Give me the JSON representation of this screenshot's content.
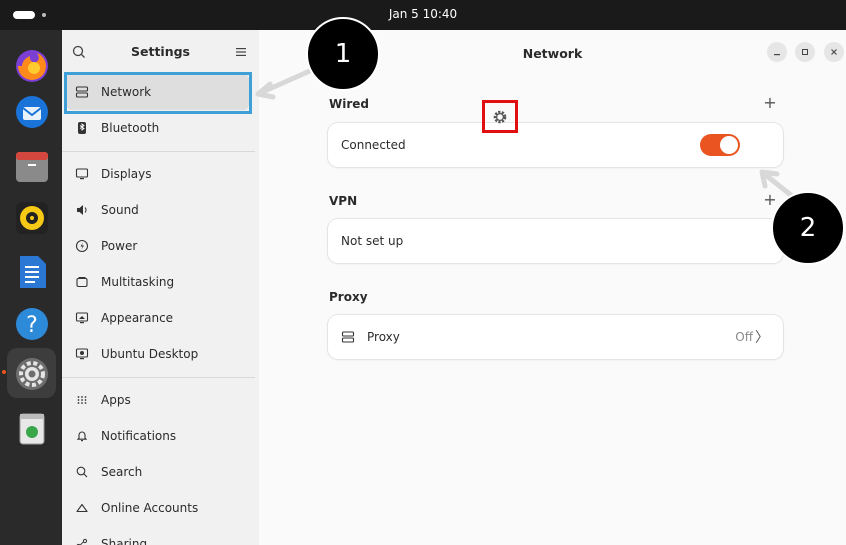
{
  "topbar": {
    "clock": "Jan 5  10:40"
  },
  "dock": {
    "items": [
      "firefox-icon",
      "thunderbird-icon",
      "files-icon",
      "rhythmbox-icon",
      "writer-icon",
      "help-icon",
      "settings-icon",
      "trash-icon"
    ]
  },
  "sidebar": {
    "title": "Settings",
    "items": [
      {
        "label": "Network",
        "icon": "network-icon",
        "selected": true
      },
      {
        "label": "Bluetooth",
        "icon": "bluetooth-icon"
      },
      {
        "label": "Displays",
        "icon": "display-icon"
      },
      {
        "label": "Sound",
        "icon": "speaker-icon"
      },
      {
        "label": "Power",
        "icon": "power-icon"
      },
      {
        "label": "Multitasking",
        "icon": "multitasking-icon"
      },
      {
        "label": "Appearance",
        "icon": "appearance-icon"
      },
      {
        "label": "Ubuntu Desktop",
        "icon": "ubuntu-desktop-icon"
      },
      {
        "label": "Apps",
        "icon": "apps-grid-icon"
      },
      {
        "label": "Notifications",
        "icon": "bell-icon"
      },
      {
        "label": "Search",
        "icon": "search-icon"
      },
      {
        "label": "Online Accounts",
        "icon": "cloud-icon"
      },
      {
        "label": "Sharing",
        "icon": "share-icon"
      }
    ]
  },
  "main": {
    "title": "Network",
    "wired": {
      "title": "Wired",
      "status": "Connected",
      "add": "+",
      "enabled": true
    },
    "vpn": {
      "title": "VPN",
      "status": "Not set up",
      "add": "+"
    },
    "proxy": {
      "title": "Proxy",
      "label": "Proxy",
      "value": "Off",
      "chevron": "〉"
    }
  },
  "callouts": {
    "one": "1",
    "two": "2"
  },
  "colors": {
    "accent": "#e95420",
    "highlight_blue": "#3fa0d8",
    "highlight_red": "#e01010"
  }
}
